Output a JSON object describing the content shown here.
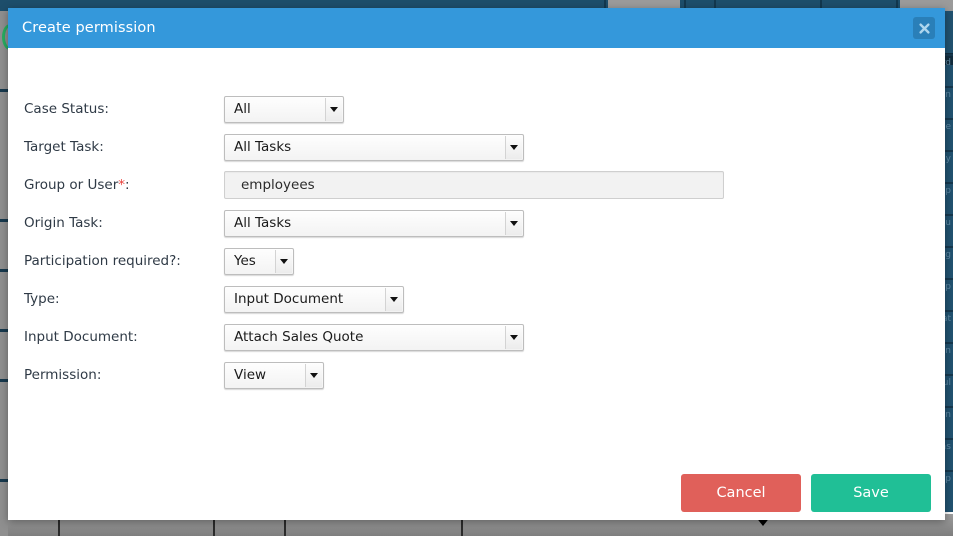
{
  "modal": {
    "title": "Create permission",
    "close_icon": "close-icon",
    "fields": [
      {
        "label": "Case Status:",
        "required": false,
        "control": "select",
        "value": "All",
        "width_class": "w-all"
      },
      {
        "label": "Target Task:",
        "required": false,
        "control": "select",
        "value": "All Tasks",
        "width_class": "w-tasks"
      },
      {
        "label": "Group or User",
        "required": true,
        "control": "text",
        "value": "employees",
        "width_class": "w-text"
      },
      {
        "label": "Origin Task:",
        "required": false,
        "control": "select",
        "value": "All Tasks",
        "width_class": "w-tasks"
      },
      {
        "label": "Participation required?:",
        "required": false,
        "control": "select",
        "value": "Yes",
        "width_class": "w-yes"
      },
      {
        "label": "Type:",
        "required": false,
        "control": "select",
        "value": "Input Document",
        "width_class": "w-type"
      },
      {
        "label": "Input Document:",
        "required": false,
        "control": "select",
        "value": "Attach Sales Quote",
        "width_class": "w-doc"
      },
      {
        "label": "Permission:",
        "required": false,
        "control": "select",
        "value": "View",
        "width_class": "w-view"
      }
    ],
    "footer": {
      "cancel_label": "Cancel",
      "save_label": "Save"
    }
  },
  "colors": {
    "header_blue": "#3498db",
    "close_blue": "#2a7fb8",
    "cancel_red": "#e0605a",
    "save_green": "#20bf96",
    "required_red": "#e8413c",
    "background_panel": "#215270",
    "background_toolbar": "#1d4e6b",
    "table_header_grey": "#8c8c8c"
  },
  "background": {
    "right_panel_rows": [
      "rd",
      "an",
      "e",
      "y",
      "p",
      "u",
      "ig",
      "ep",
      "at",
      "en",
      "ul",
      "en",
      "as",
      "up"
    ],
    "sort_arrow_icon": "sort-descending-arrow-icon"
  }
}
